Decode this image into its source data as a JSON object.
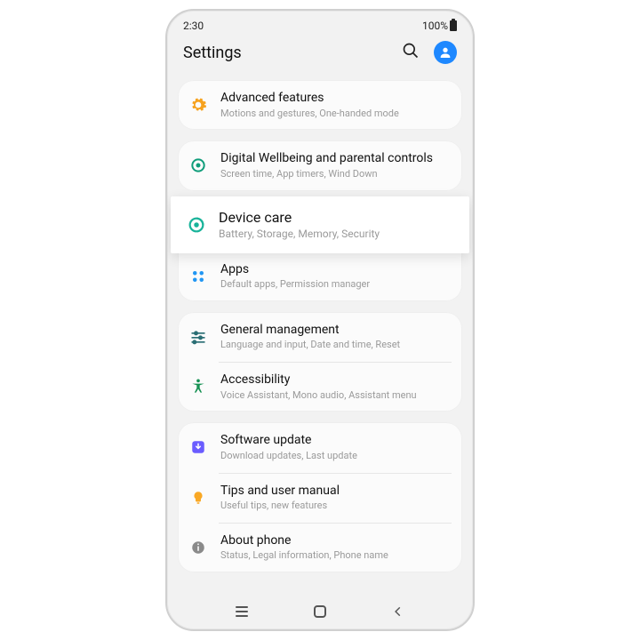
{
  "status_bar": {
    "time": "2:30",
    "battery": "100%"
  },
  "header": {
    "title": "Settings"
  },
  "groups": [
    {
      "rows": [
        {
          "icon": "gear-icon",
          "title": "Advanced features",
          "sub": "Motions and gestures, One-handed mode"
        }
      ]
    },
    {
      "rows": [
        {
          "icon": "wellbeing-icon",
          "title": "Digital Wellbeing and parental controls",
          "sub": "Screen time, App timers, Wind Down"
        }
      ]
    },
    {
      "highlighted": {
        "icon": "device-care-icon",
        "title": "Device care",
        "sub": "Battery, Storage, Memory, Security"
      },
      "rows": [
        {
          "icon": "apps-icon",
          "title": "Apps",
          "sub": "Default apps, Permission manager"
        }
      ]
    },
    {
      "rows": [
        {
          "icon": "sliders-icon",
          "title": "General management",
          "sub": "Language and input, Date and time, Reset"
        },
        {
          "icon": "person-icon",
          "title": "Accessibility",
          "sub": "Voice Assistant, Mono audio, Assistant menu"
        }
      ]
    },
    {
      "rows": [
        {
          "icon": "update-icon",
          "title": "Software update",
          "sub": "Download updates, Last update"
        },
        {
          "icon": "bulb-icon",
          "title": "Tips and user manual",
          "sub": "Useful tips, new features"
        },
        {
          "icon": "info-icon",
          "title": "About phone",
          "sub": "Status, Legal information, Phone name"
        }
      ]
    }
  ]
}
